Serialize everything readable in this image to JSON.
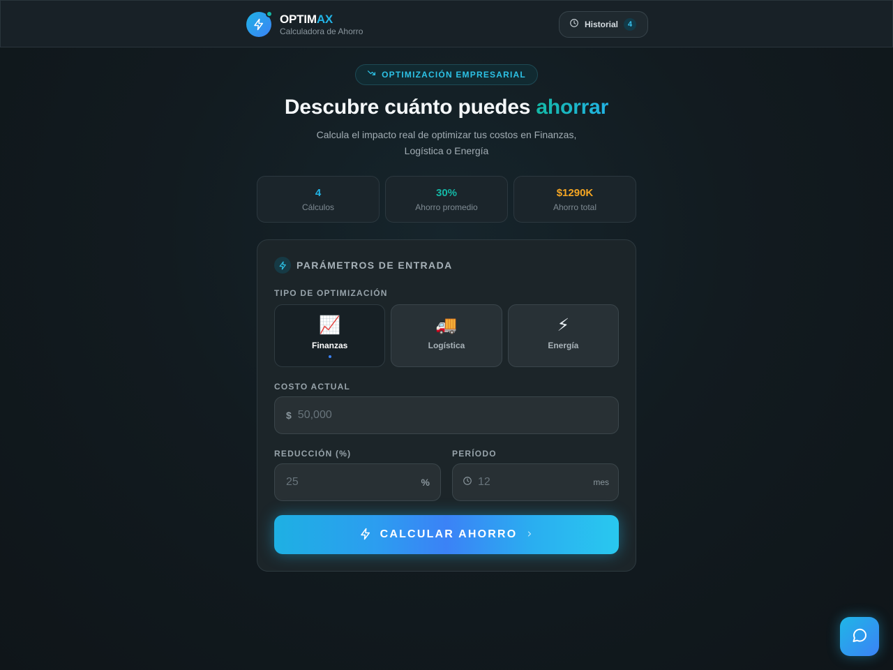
{
  "header": {
    "brand_name_part1": "OPTIM",
    "brand_name_part2": "AX",
    "brand_subtitle": "Calculadora de Ahorro",
    "history_label": "Historial",
    "history_count": "4"
  },
  "hero": {
    "badge": "OPTIMIZACIÓN EMPRESARIAL",
    "title_prefix": "Descubre cuánto puedes ",
    "title_highlight": "ahorrar",
    "subtitle_line1": "Calcula el impacto real de optimizar tus costos en Finanzas,",
    "subtitle_line2": "Logística o Energía"
  },
  "stats": [
    {
      "value": "4",
      "label": "Cálculos",
      "color": "#22b4e6"
    },
    {
      "value": "30%",
      "label": "Ahorro promedio",
      "color": "#14b8a6"
    },
    {
      "value": "$1290K",
      "label": "Ahorro total",
      "color": "#f5a623"
    }
  ],
  "form": {
    "section_title": "PARÁMETROS DE ENTRADA",
    "type_label": "TIPO DE OPTIMIZACIÓN",
    "types": [
      {
        "emoji": "📈",
        "name": "Finanzas",
        "icon": "chart-increasing-icon",
        "active": true
      },
      {
        "emoji": "🚚",
        "name": "Logística",
        "icon": "delivery-truck-icon",
        "active": false
      },
      {
        "emoji": "⚡",
        "name": "Energía",
        "icon": "high-voltage-icon",
        "active": false
      }
    ],
    "cost_label": "COSTO ACTUAL",
    "cost_prefix": "$",
    "cost_placeholder": "50,000",
    "reduction_label": "REDUCCIÓN (%)",
    "reduction_placeholder": "25",
    "reduction_suffix": "%",
    "period_label": "PERÍODO",
    "period_placeholder": "12",
    "period_suffix": "mes",
    "submit_label": "CALCULAR AHORRO"
  },
  "colors": {
    "accent": "#22b4e6",
    "teal": "#14b8a6",
    "blue": "#3b82f6",
    "gold": "#f5a623"
  }
}
